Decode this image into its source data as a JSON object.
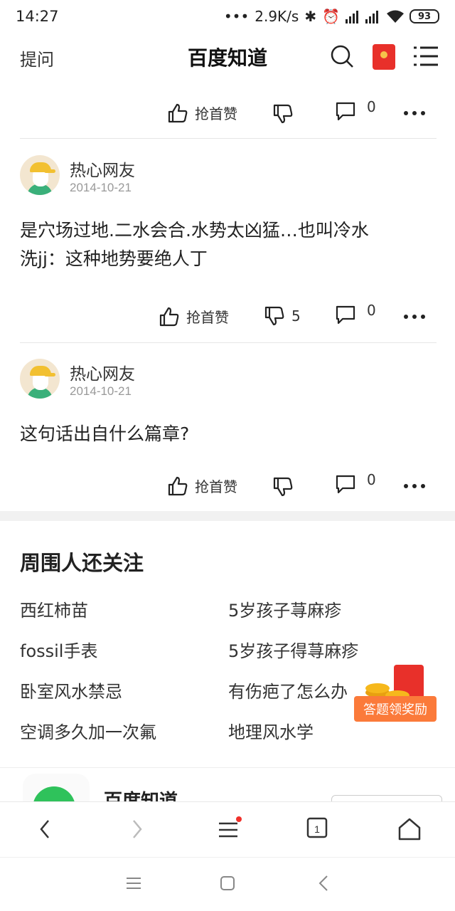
{
  "status": {
    "time": "14:27",
    "speed": "2.9K/s",
    "battery": "93"
  },
  "header": {
    "ask": "提问",
    "title": "百度知道",
    "search_icon": "search-icon",
    "redpack_icon": "red-envelope-icon",
    "menu_icon": "menu-icon"
  },
  "top_actions": {
    "like_label": "抢首赞",
    "comment_count": "0"
  },
  "comments": [
    {
      "user": "热心网友",
      "date": "2014-10-21",
      "text_line1": "是穴场过地.二水会合.水势太凶猛…也叫冷水",
      "text_line2": "洗jj：这种地势要绝人丁",
      "like_label": "抢首赞",
      "dislike_count": "5",
      "comment_count": "0"
    },
    {
      "user": "热心网友",
      "date": "2014-10-21",
      "text_line1": "这句话出自什么篇章?",
      "like_label": "抢首赞",
      "comment_count": "0"
    }
  ],
  "related": {
    "title": "周围人还关注",
    "items": [
      "西红柿苗",
      "5岁孩子荨麻疹",
      "fossil手表",
      "5岁孩子得荨麻疹",
      "卧室风水禁忌",
      "有伤疤了怎么办",
      "空调多久加一次氟",
      "地理风水学"
    ]
  },
  "reward": {
    "label": "答题领奖励"
  },
  "app_banner": {
    "name": "百度知道"
  },
  "colors": {
    "accent_red": "#e8302a",
    "reward_orange": "#fb7a3a",
    "green": "#2fc25b"
  }
}
